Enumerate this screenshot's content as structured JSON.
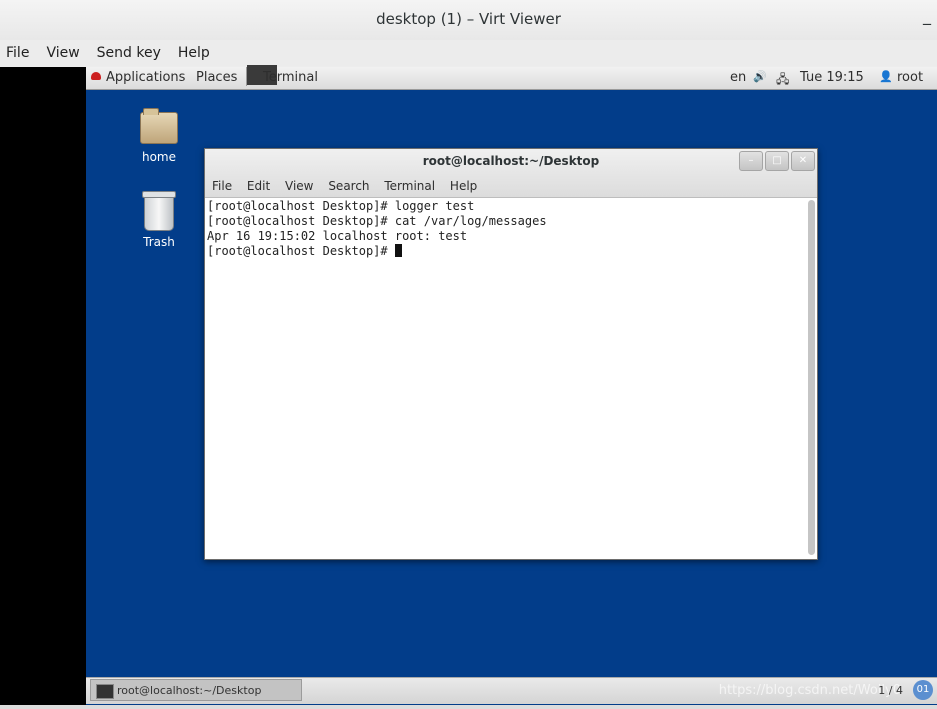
{
  "window": {
    "title": "desktop (1) – Virt Viewer",
    "minimize_glyph": "_"
  },
  "menubar": [
    "File",
    "View",
    "Send key",
    "Help"
  ],
  "panel": {
    "applications": "Applications",
    "places": "Places",
    "terminal": "Terminal",
    "lang": "en",
    "volume_icon": "🔊",
    "network_icon": "🖧",
    "clock": "Tue 19:15",
    "user_icon": "👤",
    "user": "root"
  },
  "desktop_icons": {
    "home": "home",
    "trash": "Trash"
  },
  "terminal": {
    "title": "root@localhost:~/Desktop",
    "buttons": [
      "–",
      "□",
      "✕"
    ],
    "menu": [
      "File",
      "Edit",
      "View",
      "Search",
      "Terminal",
      "Help"
    ],
    "lines": [
      "[root@localhost Desktop]# logger test",
      "[root@localhost Desktop]# cat /var/log/messages",
      "Apr 16 19:15:02 localhost root: test",
      "[root@localhost Desktop]# "
    ]
  },
  "taskbar": {
    "task": "root@localhost:~/Desktop",
    "watermark": "https://blog.csdn.net/Wolly0",
    "pager": "1 / 4",
    "avatar": "01"
  }
}
